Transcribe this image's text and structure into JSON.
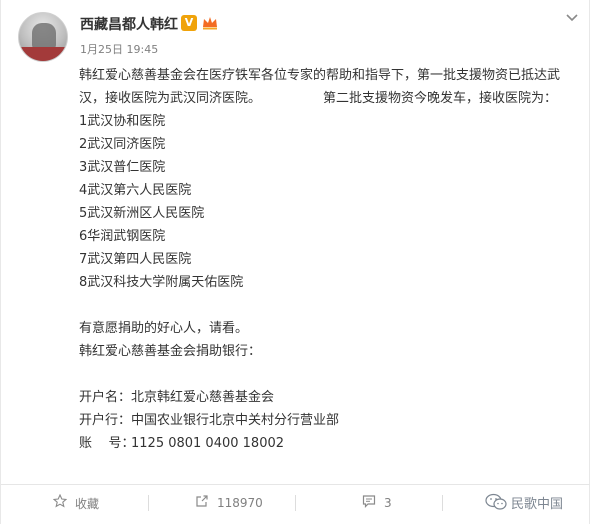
{
  "post": {
    "username": "西藏昌都人韩红",
    "verify_icon": "verified-v-icon",
    "verify_glyph": "V",
    "member_icon": "vip-crown-icon",
    "timestamp": "1月25日 19:45",
    "menu_icon": "chevron-down-icon",
    "paragraph_part1": "韩红爱心慈善基金会在医疗铁军各位专家的帮助和指导下，第一批支援物资已抵达武汉，接收医院为武汉同济医院。",
    "paragraph_part2": "第二批支援物资今晚发车，接收医院为：",
    "hospitals": [
      "1武汉协和医院",
      "2武汉同济医院",
      "3武汉普仁医院",
      "4武汉第六人民医院",
      "5武汉新洲区人民医院",
      "6华润武钢医院",
      "7武汉第四人民医院",
      "8武汉科技大学附属天佑医院"
    ],
    "donation_call": "有意愿捐助的好心人，请看。",
    "bank_heading": "韩红爱心慈善基金会捐助银行：",
    "account_name_label": "开户名：",
    "account_name": "北京韩红爱心慈善基金会",
    "bank_label": "开户行：",
    "bank": "中国农业银行北京中关村分行营业部",
    "account_no_label": "账    号：",
    "account_no": "1125 0801 0400 18002"
  },
  "actions": {
    "favorite_label": "收藏",
    "favorite_icon": "star-icon",
    "repost_count": "118970",
    "repost_icon": "repost-icon",
    "comment_count": "3",
    "comment_icon": "comment-icon"
  },
  "watermark": {
    "text": "民歌中国",
    "icon": "wechat-icon"
  },
  "colors": {
    "username": "#333333",
    "text": "#333333",
    "meta": "#808080",
    "verify_badge": "#f0a30a",
    "member_badge": "#f36b22"
  }
}
